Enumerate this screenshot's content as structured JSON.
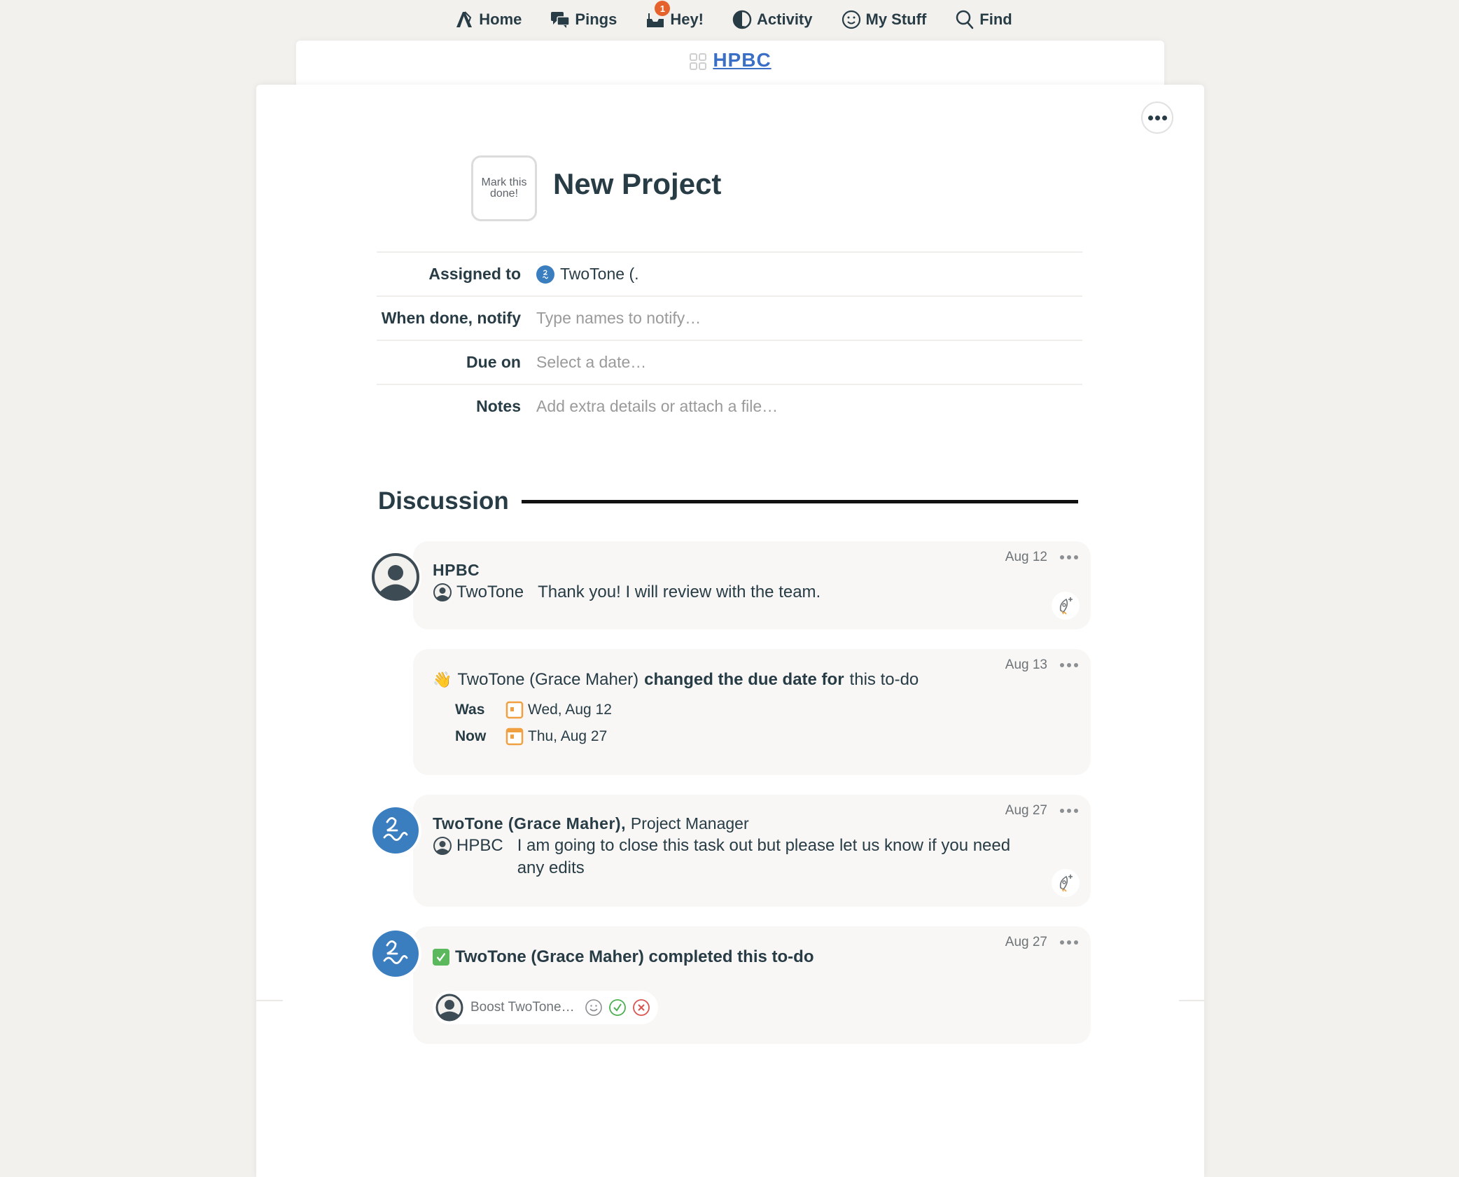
{
  "nav": {
    "items": [
      {
        "label": "Home",
        "icon": "home-icon"
      },
      {
        "label": "Pings",
        "icon": "pings-icon"
      },
      {
        "label": "Hey!",
        "icon": "hey-icon",
        "badge": "1"
      },
      {
        "label": "Activity",
        "icon": "activity-icon"
      },
      {
        "label": "My Stuff",
        "icon": "my-stuff-icon"
      },
      {
        "label": "Find",
        "icon": "find-icon"
      }
    ]
  },
  "breadcrumb": {
    "project": "HPBC"
  },
  "todo": {
    "mark_done_label": "Mark this done!",
    "title": "New Project",
    "fields": {
      "assigned_to": {
        "label": "Assigned to",
        "value": "TwoTone (."
      },
      "notify": {
        "label": "When done, notify",
        "placeholder": "Type names to notify…"
      },
      "due_on": {
        "label": "Due on",
        "placeholder": "Select a date…"
      },
      "notes": {
        "label": "Notes",
        "placeholder": "Add extra details or attach a file…"
      }
    }
  },
  "discussion": {
    "heading": "Discussion",
    "entries": [
      {
        "type": "comment",
        "author": "HPBC",
        "role": "",
        "date": "Aug 12",
        "mention": "TwoTone",
        "text": "Thank you! I will review with the team."
      },
      {
        "type": "due-change",
        "date": "Aug 13",
        "actor": "TwoTone (Grace Maher)",
        "action": "changed the due date for",
        "object": "this to-do",
        "was_label": "Was",
        "was_value": "Wed, Aug 12",
        "now_label": "Now",
        "now_value": "Thu, Aug 27"
      },
      {
        "type": "comment",
        "author": "TwoTone (Grace Maher),",
        "role": "Project Manager",
        "date": "Aug 27",
        "mention": "HPBC",
        "text": "I am going to close this task out but please let us know if you need any edits"
      },
      {
        "type": "completed",
        "date": "Aug 27",
        "text": "TwoTone (Grace Maher) completed this to-do",
        "boost_placeholder": "Boost TwoTone…"
      }
    ]
  },
  "colors": {
    "accent_blue": "#3b6fc6",
    "avatar_blue": "#3a7ebf",
    "badge_orange": "#e5622c",
    "complete_green": "#5cb85c",
    "calendar_orange": "#f0a040",
    "cancel_red": "#d9534f"
  }
}
